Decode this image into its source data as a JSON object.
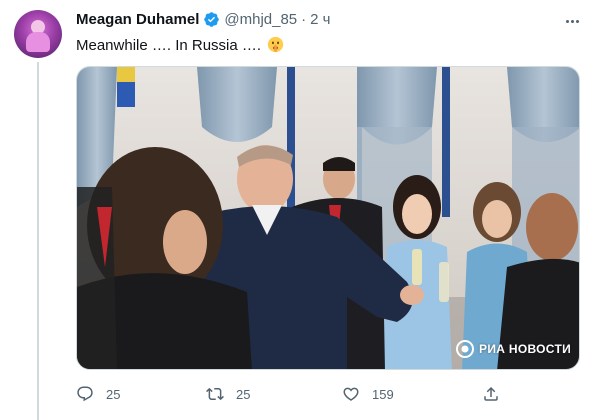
{
  "tweet": {
    "author_name": "Meagan Duhamel",
    "handle": "@mhjd_85",
    "separator": "·",
    "time": "2 ч",
    "text": "Meanwhile …. In Russia ….",
    "emoji": "shushing-face-emoji",
    "verified": true
  },
  "media": {
    "watermark": "РИА НОВОСТИ"
  },
  "actions": {
    "reply_count": "25",
    "retweet_count": "25",
    "like_count": "159"
  },
  "colors": {
    "text": "#0f1419",
    "secondary": "#536471",
    "verified": "#1d9bf0",
    "divider": "#cfd9de"
  }
}
